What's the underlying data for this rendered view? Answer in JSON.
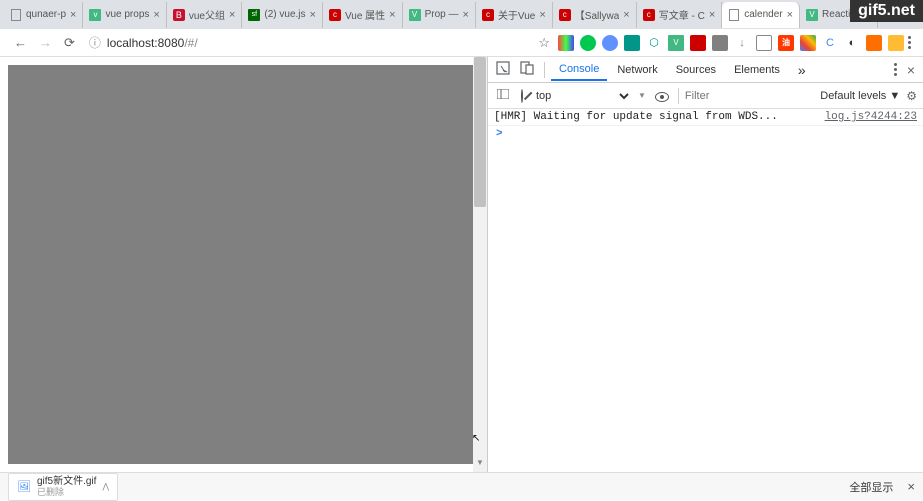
{
  "watermark": "gif5.net",
  "tabs": [
    {
      "title": "qunaer-p",
      "favicon": "doc"
    },
    {
      "title": "vue props",
      "favicon": "vue"
    },
    {
      "title": "vue父组",
      "favicon": "bd"
    },
    {
      "title": "(2) vue.js",
      "favicon": "sf"
    },
    {
      "title": "Vue 属性",
      "favicon": "csdn"
    },
    {
      "title": "Prop —",
      "favicon": "vue"
    },
    {
      "title": "关于Vue",
      "favicon": "csdn"
    },
    {
      "title": "【Sallywa",
      "favicon": "csdn"
    },
    {
      "title": "写文章 - C",
      "favicon": "csdn"
    },
    {
      "title": "calender",
      "favicon": "doc",
      "active": true
    },
    {
      "title": "Reactivit",
      "favicon": "vue"
    }
  ],
  "url": {
    "host": "localhost:8080",
    "path": "/#/"
  },
  "devtools": {
    "tabs": [
      "Console",
      "Network",
      "Sources",
      "Elements"
    ],
    "active": "Console",
    "context": "top",
    "filter_placeholder": "Filter",
    "levels": "Default levels ▼"
  },
  "console": {
    "rows": [
      {
        "msg": "[HMR] Waiting for update signal from WDS...",
        "src": "log.js?4244:23"
      }
    ],
    "prompt": ">"
  },
  "download": {
    "name": "gif5新文件.gif",
    "sub": "已删除",
    "show_all": "全部显示"
  }
}
